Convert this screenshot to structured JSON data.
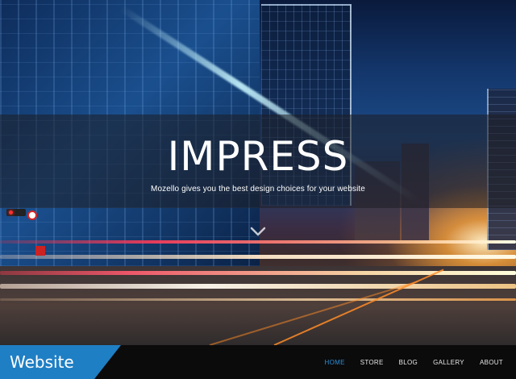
{
  "hero": {
    "title": "IMPRESS",
    "subtitle": "Mozello gives you the best design choices for your website",
    "scroll_icon": "chevron-down-icon"
  },
  "navbar": {
    "brand": "Website",
    "items": [
      {
        "label": "HOME",
        "active": true
      },
      {
        "label": "STORE",
        "active": false
      },
      {
        "label": "BLOG",
        "active": false
      },
      {
        "label": "GALLERY",
        "active": false
      },
      {
        "label": "ABOUT",
        "active": false
      }
    ]
  },
  "colors": {
    "accent": "#1f7fc4",
    "active_nav": "#2b8fd6",
    "nav_background": "#0b0b0c"
  }
}
